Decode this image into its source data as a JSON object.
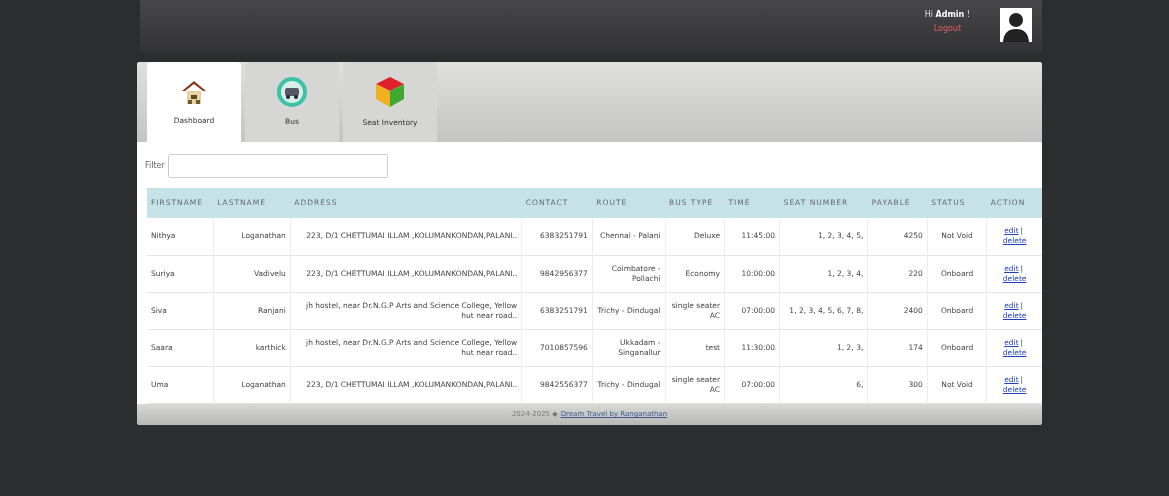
{
  "header": {
    "greeting_prefix": "Hi",
    "user": "Admin",
    "greeting_suffix": "!",
    "logout": "Logout"
  },
  "tabs": [
    {
      "label": "Dashboard",
      "selected": true
    },
    {
      "label": "Bus",
      "selected": false
    },
    {
      "label": "Seat Inventory",
      "selected": false
    }
  ],
  "filter": {
    "label": "Filter"
  },
  "table": {
    "columns": [
      "FIRSTNAME",
      "LASTNAME",
      "ADDRESS",
      "CONTACT",
      "ROUTE",
      "BUS TYPE",
      "TIME",
      "SEAT NUMBER",
      "PAYABLE",
      "STATUS",
      "ACTION"
    ],
    "rows": [
      {
        "separator": "|",
        "cells": [
          "Nithya",
          "Loganathan",
          "223, D/1 CHETTUMAI ILLAM ,KOLUMANKONDAN,PALANI..",
          "6383251791",
          "Chennai - Palani",
          "Deluxe",
          "11:45:00",
          "1, 2, 3, 4, 5,",
          "4250",
          "Not Void"
        ],
        "actions": [
          "edit",
          "delete"
        ]
      },
      {
        "separator": "|",
        "cells": [
          "Suriya",
          "Vadivelu",
          "223, D/1 CHETTUMAI ILLAM ,KOLUMANKONDAN,PALANI..",
          "9842956377",
          "Coimbatore - Pollachi",
          "Economy",
          "10:00:00",
          "1, 2, 3, 4,",
          "220",
          "Onboard"
        ],
        "actions": [
          "edit",
          "delete"
        ]
      },
      {
        "separator": "|",
        "cells": [
          "Siva",
          "Ranjani",
          "jh hostel, near Dr.N.G.P Arts and Science College, Yellow hut near road..",
          "6383251791",
          "Trichy - Dindugal",
          "single seater AC",
          "07:00:00",
          "1, 2, 3, 4, 5, 6, 7, 8,",
          "2400",
          "Onboard"
        ],
        "actions": [
          "edit",
          "delete"
        ]
      },
      {
        "separator": "|",
        "cells": [
          "Saara",
          "karthick",
          "jh hostel, near Dr.N.G.P Arts and Science College, Yellow hut near road..",
          "7010857596",
          "Ukkadam - Singanallur",
          "test",
          "11:30:00",
          "1, 2, 3,",
          "174",
          "Onboard"
        ],
        "actions": [
          "edit",
          "delete"
        ]
      },
      {
        "separator": "|",
        "cells": [
          "Uma",
          "Loganathan",
          "223, D/1 CHETTUMAI ILLAM ,KOLUMANKONDAN,PALANI..",
          "9842556377",
          "Trichy - Dindugal",
          "single seater AC",
          "07:00:00",
          "6,",
          "300",
          "Not Void"
        ],
        "actions": [
          "edit",
          "delete"
        ]
      }
    ]
  },
  "footer": {
    "text": "2024-2025 ◆",
    "link": "Dream Travel by Ranganathan"
  }
}
